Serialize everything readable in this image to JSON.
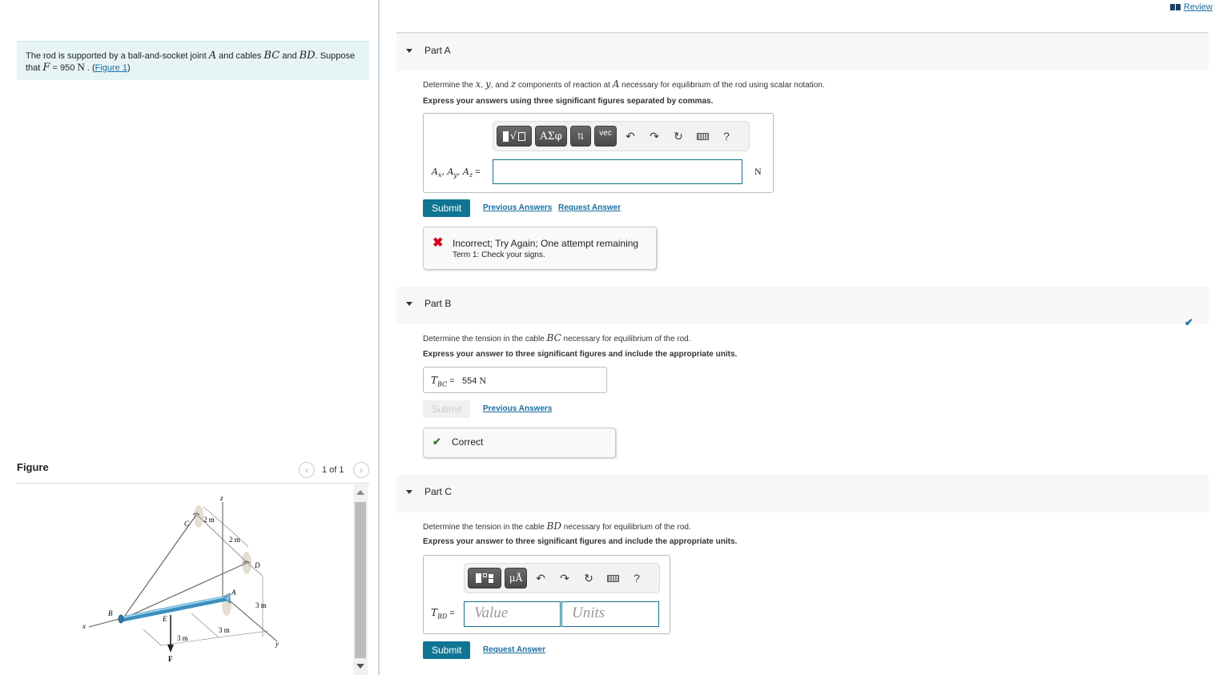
{
  "header": {
    "review_label": "Review",
    "review_icon": "book-icon"
  },
  "problem": {
    "text_1": "The rod is supported by a ball-and-socket joint ",
    "var_A": "A",
    "text_2": " and cables ",
    "var_BC": "BC",
    "text_3": " and ",
    "var_BD": "BD",
    "text_4": ". Suppose",
    "text_5": "that ",
    "var_F": "F",
    "text_6": " = 950 ",
    "unit_N": "N",
    "text_7": " . (",
    "figure_link": "Figure 1",
    "text_8": ")"
  },
  "figure": {
    "title": "Figure",
    "pager": "1 of 1",
    "prev_icon": "chevron-left-icon",
    "next_icon": "chevron-right-icon",
    "labels": {
      "z": "z",
      "x": "x",
      "y": "y",
      "C": "C",
      "D": "D",
      "A": "A",
      "B": "B",
      "E": "E",
      "F": "F",
      "dim_cd1": "2 m",
      "dim_cd2": "2 m",
      "dim_h": "3 m",
      "dim_be": "3 m",
      "dim_ea": "3 m"
    }
  },
  "parts": [
    {
      "title": "Part A",
      "question_1": "Determine the ",
      "q_x": "x",
      "q_sep1": ", ",
      "q_y": "y",
      "q_sep2": ", and ",
      "q_z": "z",
      "question_2": " components of reaction at ",
      "q_A": "A",
      "question_3": " necessary for equilibrium of the rod using scalar notation.",
      "instruction": "Express your answers using three significant figures separated by commas.",
      "toolbar": [
        "templates",
        "ΑΣφ",
        "⇅",
        "vec"
      ],
      "answer_label": "Ax, Ay, Az =",
      "answer_value": "",
      "unit": "N",
      "submit_label": "Submit",
      "links": [
        "Previous Answers",
        "Request Answer"
      ],
      "feedback": {
        "status": "incorrect",
        "title": "Incorrect; Try Again; One attempt remaining",
        "detail": "Term 1: Check your signs."
      }
    },
    {
      "title": "Part B",
      "question_1": "Determine the tension in the cable ",
      "q_var": "BC",
      "question_2": " necessary for equilibrium of the rod.",
      "instruction": "Express your answer to three significant figures and include the appropriate units.",
      "answer_label": "TBC",
      "answer_value": "554",
      "answer_unit": "N",
      "submit_label": "Submit",
      "links": [
        "Previous Answers"
      ],
      "completed": true,
      "feedback": {
        "status": "correct",
        "title": "Correct"
      }
    },
    {
      "title": "Part C",
      "question_1": "Determine the tension in the cable ",
      "q_var": "BD",
      "question_2": " necessary for equilibrium of the rod.",
      "instruction": "Express your answer to three significant figures and include the appropriate units.",
      "toolbar": [
        "templates",
        "μÅ"
      ],
      "answer_label": "TBD",
      "value_placeholder": "Value",
      "units_placeholder": "Units",
      "submit_label": "Submit",
      "links": [
        "Request Answer"
      ]
    }
  ],
  "colors": {
    "accent": "#107494",
    "link": "#1a6fa0",
    "incorrect": "#d0021b",
    "correct": "#2e7d32",
    "problem_bg": "#e6f4f6"
  }
}
